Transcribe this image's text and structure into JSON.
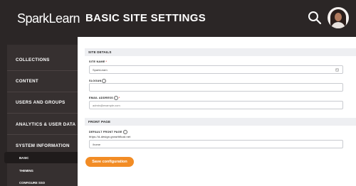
{
  "header": {
    "logo_part1": "Spark",
    "logo_part2": "Learn",
    "page_title": "BASIC SITE SETTINGS"
  },
  "sidebar": {
    "items": [
      {
        "label": "COLLECTIONS"
      },
      {
        "label": "CONTENT"
      },
      {
        "label": "USERS AND GROUPS"
      },
      {
        "label": "ANALYTICS & USER DATA"
      },
      {
        "label": "SYSTEM INFORMATION"
      }
    ],
    "sub_items": [
      {
        "label": "BASIC",
        "active": true
      },
      {
        "label": "THEMING"
      },
      {
        "label": "CONFIGURE SSO"
      }
    ]
  },
  "site_details": {
    "section_title": "SITE DETAILS",
    "site_name_label": "SITE NAME",
    "site_name_required": "*",
    "site_name_value": "SparkLearn",
    "slogan_label": "SLOGAN",
    "slogan_value": "",
    "email_label": "EMAIL ADDRESS",
    "email_required": "*",
    "email_placeholder": "admin@example.com"
  },
  "front_page": {
    "section_title": "FRONT PAGE",
    "default_label": "DEFAULT FRONT PAGE",
    "url_prefix": "https://d-design.growthfloat.net",
    "path_value": "/home"
  },
  "actions": {
    "save_label": "Save configuration"
  },
  "colors": {
    "accent": "#f28c25",
    "background": "#2b2626",
    "sidebar": "#363030"
  }
}
